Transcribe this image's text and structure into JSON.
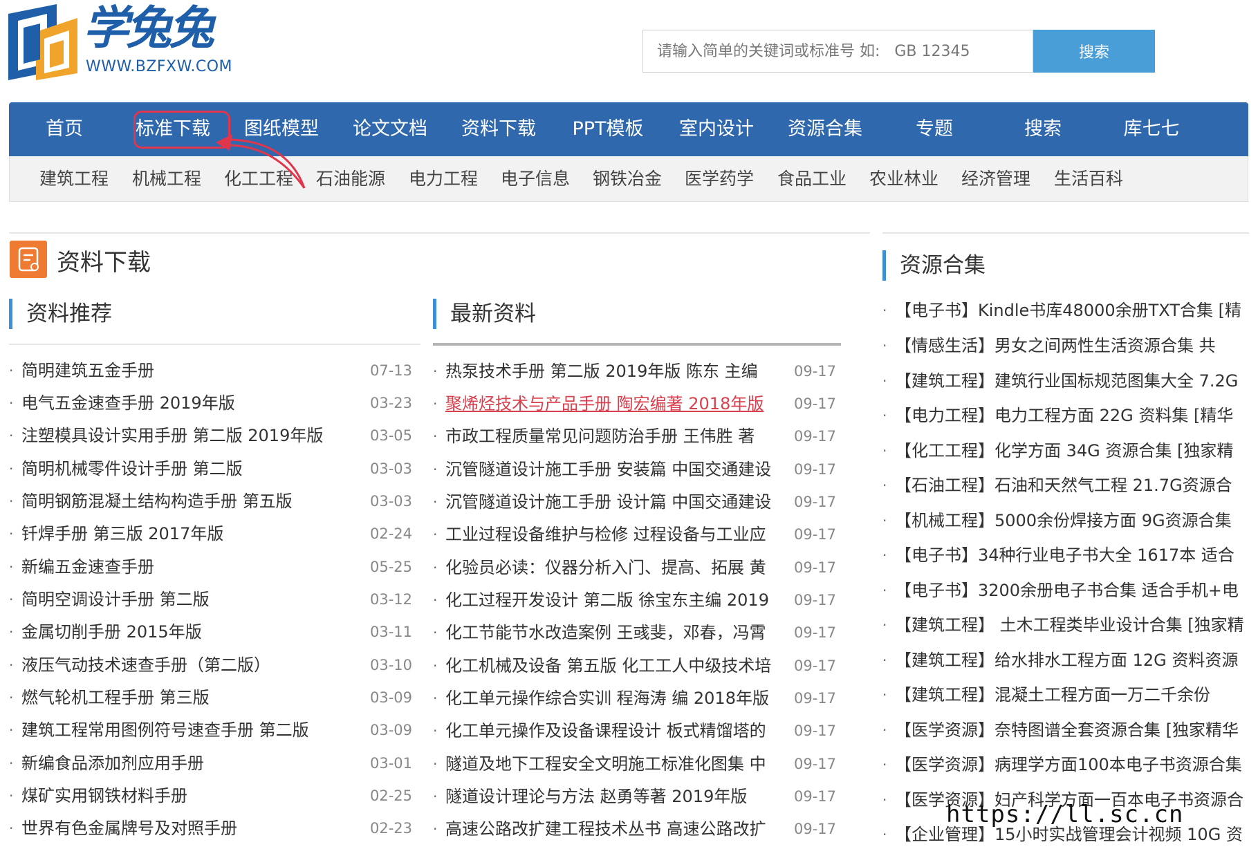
{
  "site": {
    "logo_text": "学兔兔",
    "logo_url": "WWW.BZFXW.COM",
    "brand_color": "#1f5ea8"
  },
  "search": {
    "placeholder": "请输入简单的关键词或标准号 如:   GB 12345",
    "button_label": "搜索",
    "button_color": "#4a9ed8"
  },
  "nav": {
    "bar_color": "#2f68ad",
    "highlight_color": "#e0364b",
    "highlighted_index": 1,
    "items": [
      "首页",
      "标准下载",
      "图纸模型",
      "论文文档",
      "资料下载",
      "PPT模板",
      "室内设计",
      "资源合集",
      "专题",
      "搜索",
      "库七七"
    ]
  },
  "subnav": {
    "items": [
      "建筑工程",
      "机械工程",
      "化工工程",
      "石油能源",
      "电力工程",
      "电子信息",
      "钢铁冶金",
      "医学药学",
      "食品工业",
      "农业林业",
      "经济管理",
      "生活百科"
    ]
  },
  "main_section": {
    "title": "资料下载",
    "icon": "document-icon",
    "icon_color": "#ef7b32"
  },
  "recommended": {
    "title": "资料推荐",
    "items": [
      {
        "title": "简明建筑五金手册",
        "date": "07-13"
      },
      {
        "title": "电气五金速查手册 2019年版",
        "date": "03-23"
      },
      {
        "title": "注塑模具设计实用手册 第二版 2019年版",
        "date": "03-05"
      },
      {
        "title": "简明机械零件设计手册 第二版",
        "date": "03-03"
      },
      {
        "title": "简明钢筋混凝土结构构造手册 第五版",
        "date": "03-03"
      },
      {
        "title": "钎焊手册 第三版 2017年版",
        "date": "02-24"
      },
      {
        "title": "新编五金速查手册",
        "date": "05-25"
      },
      {
        "title": "简明空调设计手册 第二版",
        "date": "03-12"
      },
      {
        "title": "金属切削手册 2015年版",
        "date": "03-11"
      },
      {
        "title": "液压气动技术速查手册（第二版）",
        "date": "03-10"
      },
      {
        "title": "燃气轮机工程手册 第三版",
        "date": "03-09"
      },
      {
        "title": "建筑工程常用图例符号速查手册 第二版",
        "date": "03-09"
      },
      {
        "title": "新编食品添加剂应用手册",
        "date": "03-01"
      },
      {
        "title": "煤矿实用钢铁材料手册",
        "date": "02-25"
      },
      {
        "title": "世界有色金属牌号及对照手册",
        "date": "02-23"
      }
    ]
  },
  "latest": {
    "title": "最新资料",
    "active_color": "#d9414f",
    "items": [
      {
        "title": "热泵技术手册 第二版 2019年版 陈东 主编",
        "date": "09-17",
        "active": false
      },
      {
        "title": "聚烯烃技术与产品手册 陶宏编著 2018年版",
        "date": "09-17",
        "active": true
      },
      {
        "title": "市政工程质量常见问题防治手册 王伟胜 著",
        "date": "09-17",
        "active": false
      },
      {
        "title": "沉管隧道设计施工手册 安装篇 中国交通建设",
        "date": "09-17",
        "active": false
      },
      {
        "title": "沉管隧道设计施工手册 设计篇 中国交通建设",
        "date": "09-17",
        "active": false
      },
      {
        "title": "工业过程设备维护与检修 过程设备与工业应",
        "date": "09-17",
        "active": false
      },
      {
        "title": "化验员必读：仪器分析入门、提高、拓展 黄",
        "date": "09-17",
        "active": false
      },
      {
        "title": "化工过程开发设计 第二版 徐宝东主编 2019",
        "date": "09-17",
        "active": false
      },
      {
        "title": "化工节能节水改造案例 王彧斐，邓春，冯霄",
        "date": "09-17",
        "active": false
      },
      {
        "title": "化工机械及设备 第五版 化工工人中级技术培",
        "date": "09-17",
        "active": false
      },
      {
        "title": "化工单元操作综合实训 程海涛 编 2018年版",
        "date": "09-17",
        "active": false
      },
      {
        "title": "化工单元操作及设备课程设计 板式精馏塔的",
        "date": "09-17",
        "active": false
      },
      {
        "title": "隧道及地下工程安全文明施工标准化图集 中",
        "date": "09-17",
        "active": false
      },
      {
        "title": "隧道设计理论与方法 赵勇等著 2019年版",
        "date": "09-17",
        "active": false
      },
      {
        "title": "高速公路改扩建工程技术丛书 高速公路改扩",
        "date": "09-17",
        "active": false
      }
    ]
  },
  "collections": {
    "title": "资源合集",
    "items": [
      "【电子书】Kindle书库48000余册TXT合集 [精",
      "【情感生活】男女之间两性生活资源合集 共",
      "【建筑工程】建筑行业国标规范图集大全 7.2G",
      "【电力工程】电力工程方面 22G 资料集 [精华",
      "【化工工程】化学方面 34G 资源合集 [独家精",
      "【石油工程】石油和天然气工程 21.7G资源合",
      "【机械工程】5000余份焊接方面 9G资源合集",
      "【电子书】34种行业电子书大全 1617本 适合",
      "【电子书】3200余册电子书合集 适合手机+电",
      "【建筑工程】 土木工程类毕业设计合集 [独家精",
      "【建筑工程】给水排水工程方面 12G 资料资源",
      "【建筑工程】混凝土工程方面一万二千余份",
      "【医学资源】奈特图谱全套资源合集 [独家精华",
      "【医学资源】病理学方面100本电子书资源合集",
      "【医学资源】妇产科学方面一百本电子书资源合",
      "【企业管理】15小时实战管理会计视频 10G 资"
    ]
  },
  "watermark": "https://ll.sc.cn"
}
